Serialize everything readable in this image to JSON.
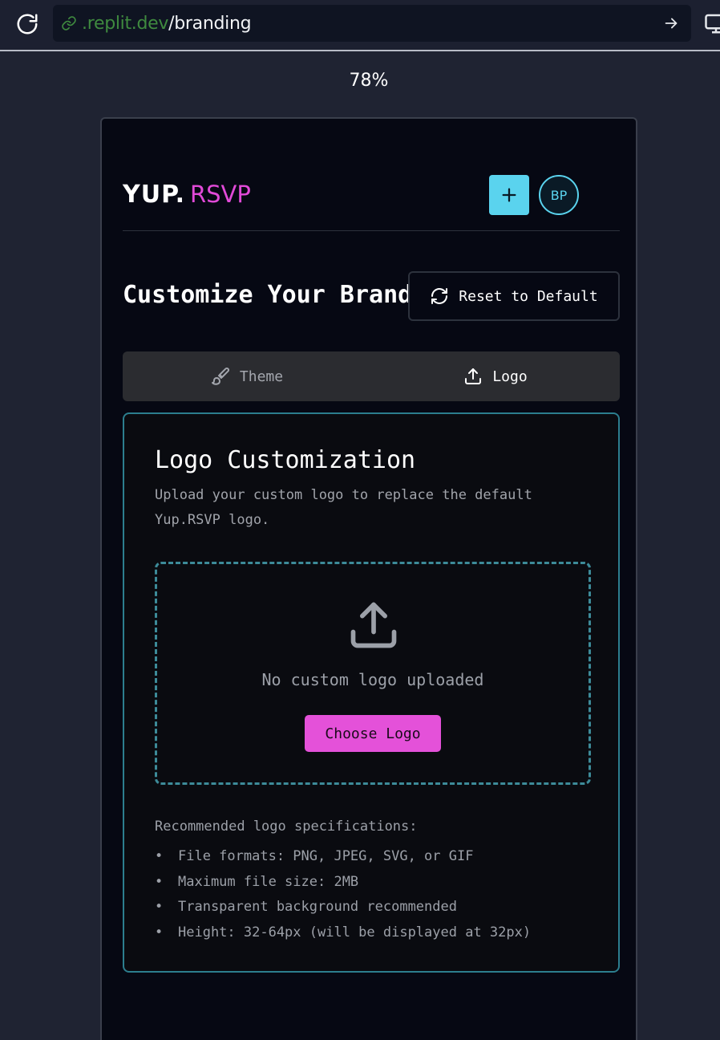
{
  "browser": {
    "url_domain": ".replit.dev",
    "url_path": "/branding",
    "zoom": "78%"
  },
  "header": {
    "logo_main": "YUP.",
    "logo_accent": "RSVP",
    "add_label": "+",
    "avatar_initials": "BP"
  },
  "page": {
    "title": "Customize Your Brand",
    "reset_label": "Reset to Default"
  },
  "tabs": [
    {
      "label": "Theme",
      "icon": "paintbrush-icon",
      "active": false
    },
    {
      "label": "Logo",
      "icon": "upload-icon",
      "active": true
    }
  ],
  "logo_card": {
    "title": "Logo Customization",
    "description": "Upload your custom logo to replace the default Yup.RSVP logo.",
    "empty_text": "No custom logo uploaded",
    "choose_label": "Choose Logo",
    "spec_title": "Recommended logo specifications:",
    "specs": [
      "File formats: PNG, JPEG, SVG, or GIF",
      "Maximum file size: 2MB",
      "Transparent background recommended",
      "Height: 32-64px (will be displayed at 32px)"
    ]
  },
  "colors": {
    "accent_cyan": "#5ad3ee",
    "accent_pink": "#e451d9",
    "card_border": "#2c7e8e"
  }
}
